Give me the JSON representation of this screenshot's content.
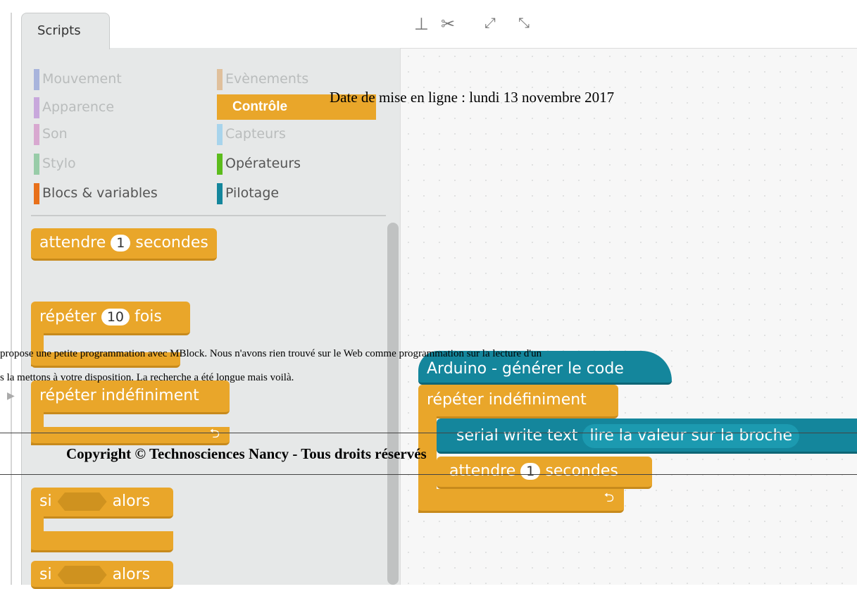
{
  "tabs": {
    "scripts": "Scripts"
  },
  "toolbar_icons": [
    "stamp-icon",
    "scissors-icon",
    "grow-icon",
    "shrink-icon"
  ],
  "categories": {
    "left": [
      {
        "label": "Mouvement",
        "color": "#a8b4dc"
      },
      {
        "label": "Apparence",
        "color": "#c8a8dc"
      },
      {
        "label": "Son",
        "color": "#d8a8d0"
      },
      {
        "label": "Stylo",
        "color": "#98cca8"
      },
      {
        "label": "Blocs & variables",
        "color": "#e8701a"
      }
    ],
    "right": [
      {
        "label": "Evènements",
        "color": "#e0c09c"
      },
      {
        "label": "Contrôle",
        "color": "#e9a62a"
      },
      {
        "label": "Capteurs",
        "color": "#a8d4ec"
      },
      {
        "label": "Opérateurs",
        "color": "#5cbc1c"
      },
      {
        "label": "Pilotage",
        "color": "#14869c"
      }
    ]
  },
  "palette_blocks": {
    "wait_prefix": "attendre",
    "wait_value": "1",
    "wait_suffix": "secondes",
    "repeat_prefix": "répéter",
    "repeat_value": "10",
    "repeat_suffix": "fois",
    "forever": "répéter indéfiniment",
    "if1_prefix": "si",
    "if1_suffix": "alors",
    "if2_prefix": "si",
    "if2_suffix": "alors",
    "loop_arrow": "⮌"
  },
  "script_blocks": {
    "hat": "Arduino - générer le code",
    "forever": "répéter indéfiniment",
    "serial": "serial write text",
    "serial_arg": "lire la valeur sur la broche",
    "wait_prefix": "attendre",
    "wait_value": "1",
    "wait_suffix": "secondes",
    "loop_arrow": "⮌"
  },
  "page_overlay": {
    "date": "Date de mise en ligne : lundi 13 novembre 2017",
    "line1": "propose une petite programmation avec MBlock. Nous n'avons rien trouvé sur le Web comme  programmation sur la  lecture d'un",
    "line2": "s la mettons à votre disposition. La recherche a été longue mais voilà.",
    "copyright": "Copyright © Technosciences Nancy - Tous droits réservés"
  },
  "colors": {
    "control": "#e9a62a",
    "pilotage": "#14869c"
  }
}
